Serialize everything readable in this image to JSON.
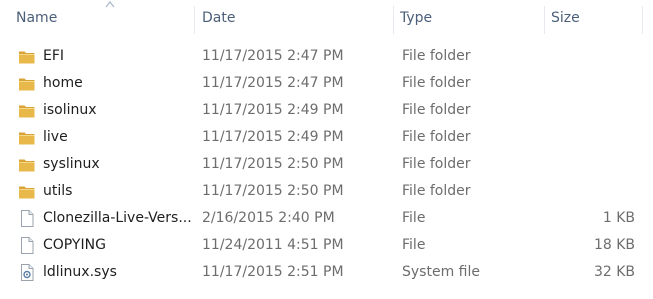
{
  "columns": {
    "name": "Name",
    "date": "Date",
    "type": "Type",
    "size": "Size"
  },
  "colors": {
    "header_text": "#4c607a",
    "folder_icon": "#e8b84a",
    "row_text": "#1e1e1e",
    "meta_text": "#6d6d6d"
  },
  "files": [
    {
      "name": "EFI",
      "date": "11/17/2015 2:47 PM",
      "type": "File folder",
      "size": "",
      "icon": "folder-icon"
    },
    {
      "name": "home",
      "date": "11/17/2015 2:47 PM",
      "type": "File folder",
      "size": "",
      "icon": "folder-icon"
    },
    {
      "name": "isolinux",
      "date": "11/17/2015 2:49 PM",
      "type": "File folder",
      "size": "",
      "icon": "folder-icon"
    },
    {
      "name": "live",
      "date": "11/17/2015 2:49 PM",
      "type": "File folder",
      "size": "",
      "icon": "folder-icon"
    },
    {
      "name": "syslinux",
      "date": "11/17/2015 2:50 PM",
      "type": "File folder",
      "size": "",
      "icon": "folder-icon"
    },
    {
      "name": "utils",
      "date": "11/17/2015 2:50 PM",
      "type": "File folder",
      "size": "",
      "icon": "folder-icon"
    },
    {
      "name": "Clonezilla-Live-Vers...",
      "date": "2/16/2015 2:40 PM",
      "type": "File",
      "size": "1 KB",
      "icon": "file-icon"
    },
    {
      "name": "COPYING",
      "date": "11/24/2011 4:51 PM",
      "type": "File",
      "size": "18 KB",
      "icon": "file-icon"
    },
    {
      "name": "ldlinux.sys",
      "date": "11/17/2015 2:51 PM",
      "type": "System file",
      "size": "32 KB",
      "icon": "system-file-icon"
    }
  ]
}
